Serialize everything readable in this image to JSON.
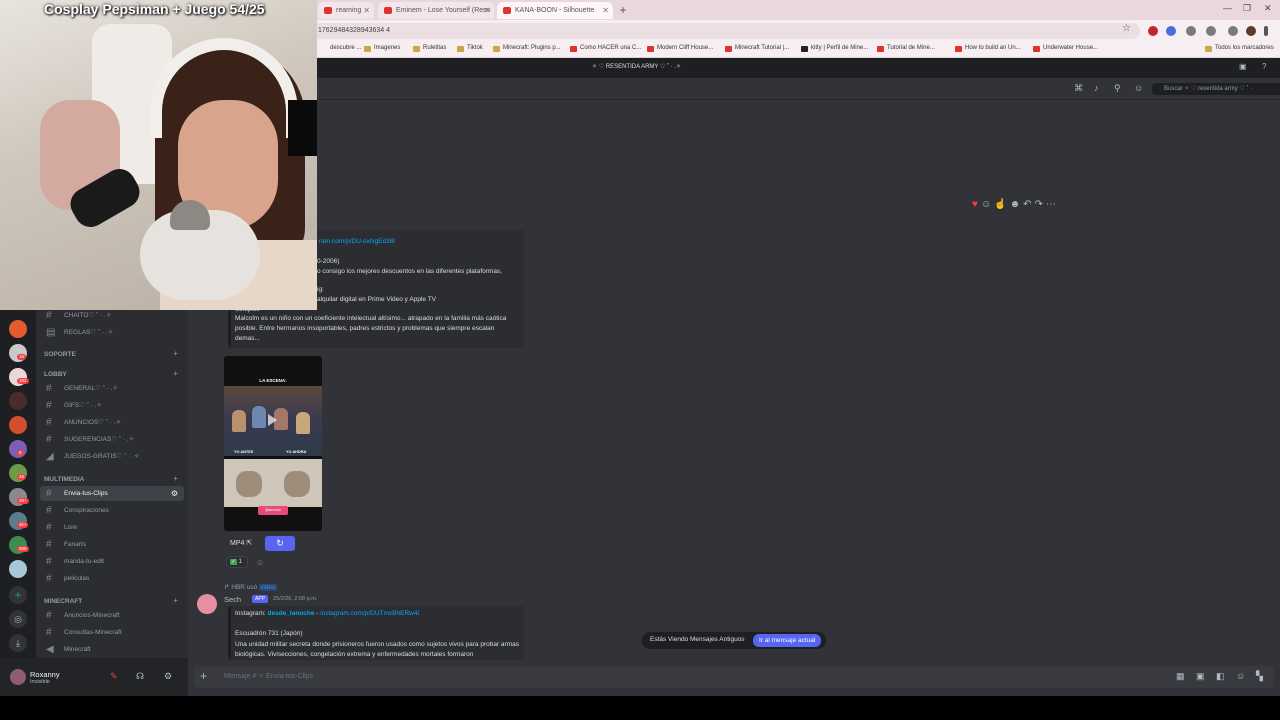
{
  "stream": {
    "title": "Cosplay Pepsiman + Juego 54/25"
  },
  "browser": {
    "tabs": [
      {
        "label": "reaming"
      },
      {
        "label": "Eminem - Lose Yourself (Remi"
      },
      {
        "label": "KANA-BOON - Silhouette"
      }
    ],
    "url": "17629484328943634 4",
    "bookmarks": [
      "descubre ...",
      "Imagenes",
      "Ruletitas",
      "Tiktok",
      "Minecraft: Plugins p...",
      "Como HACER una C...",
      "Modern Cliff House...",
      "Minecraft Tutorial |...",
      "kitty | Perfil de Mine...",
      "Tutorial de Mine...",
      "How to build an Un...",
      "Underwater House...",
      "Todos los marcadores"
    ]
  },
  "discord": {
    "server_title": "✧ ♡ RESENTIDA ARMY ♡ ˚ · .✧",
    "search_placeholder": "Buscar ✧ ♡ resentida army ♡ ˚ ·",
    "categories": [
      {
        "label": "SOPORTE"
      },
      {
        "label": "LOBBY"
      },
      {
        "label": "MULTIMEDIA"
      },
      {
        "label": "MINECRAFT"
      }
    ],
    "channels": {
      "chat": "CHAITO♡ ˚ · .✧",
      "reglas": "REGLAS♡ ˚ · .✧",
      "general": "GENERAL♡ ˚ · .✧",
      "gifs": "GIFS♡ ˚ · .✧",
      "anuncios": "ANUNCIOS♡ ˚ · .✧",
      "sugerencias": "SUGERENCIAS♡ ˚ · .✧",
      "juegos": "JUEGOS-GRATIS♡ ˚ · .✧",
      "clips": "Envia-tus-Clips",
      "conspiraciones": "Conspiraciones",
      "lore": "Lore",
      "fanarts": "Fanarts",
      "edit": "manda-tu-edit",
      "peliculas": "peliculas",
      "anuncios_mc": "Anuncios-Minecraft",
      "consultas_mc": "Consultas-Minecraft",
      "minecraft": "Minecraft"
    },
    "user": {
      "name": "Roxanny",
      "status": "Invisible"
    },
    "guild_badges": [
      "16",
      "192",
      "8",
      "46",
      "29+",
      "4k+",
      "586"
    ],
    "embed": {
      "link": "ram.com/p/DU-oxNgEd38/",
      "line1": "0-2006)",
      "line2": "o consigo los mejores descuentos en las diferentes plataformas,",
      "line3": "ig:",
      "line4": "alquilar digital en Prime Video y Apple TV",
      "line5": "Sinopsis",
      "synopsis": "Malcolm es un niño con un coeficiente intelectual altísimo... atrapado en la familia más caótica posible. Entre hermanos insoportables, padres estrictos y problemas que siempre escalan demas..."
    },
    "video": {
      "caption": "LA ESCENA:",
      "sub_left": "YO ANTES",
      "sub_right": "YO AHORA",
      "tag": "@lanoche"
    },
    "attachment": {
      "label": "MP4"
    },
    "reaction": {
      "count": "1"
    },
    "reply": {
      "prefix": "HBR",
      "used": "usó",
      "command": "video"
    },
    "message": {
      "author": "Sech",
      "badge": "APP",
      "time": "25/2/26, 2:08 p.m.",
      "instagram_label": "Instagram:",
      "instagram_user": "desde_lanoche",
      "instagram_link": "instagram.com/p/DUTmvBhERw4/",
      "title": "Escuadrón 731 (Japón)",
      "body": "Una unidad militar secreta donde prisioneros fueron usados como sujetos vivos para probar armas biológicas. Vivisecciones, congelación extrema y enfermedades mortales formaron"
    },
    "old_messages": {
      "text": "Estás Viendo Mensajes Antiguos",
      "jump": "Ir al mensaje actual"
    },
    "composer": {
      "placeholder": "Mensaje # ✧ Envia-tus-Clips"
    }
  }
}
